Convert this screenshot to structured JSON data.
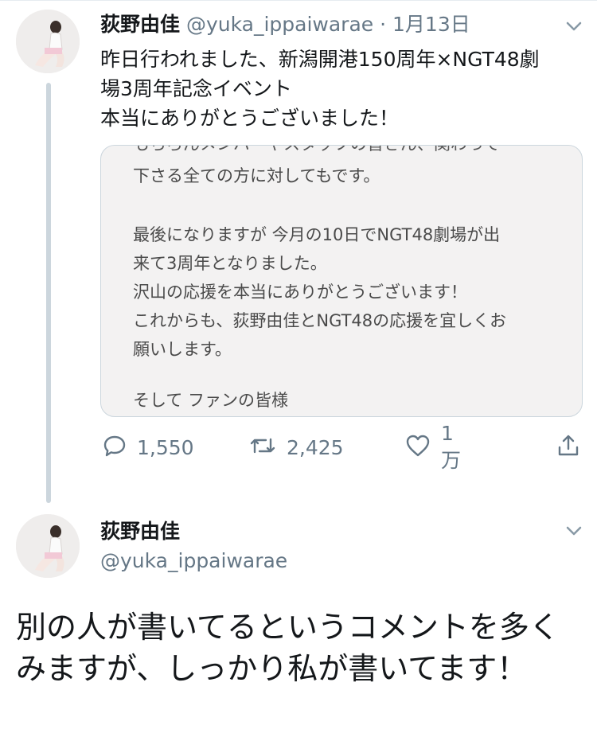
{
  "tweet1": {
    "name": "荻野由佳",
    "handle": "@yuka_ippaiwarae",
    "separator": "·",
    "date": "1月13日",
    "text_line1": "昨日行われました、新潟開港150周年×NGT48劇",
    "text_line2": "場3周年記念イベント",
    "text_line3": "本当にありがとうございました！",
    "media_lines": {
      "cut": "もちろんメンバーやスタッフの皆さん、関わって",
      "l1": "下さる全ての方に対してもです。",
      "l2": "最後になりますが 今月の10日でNGT48劇場が出",
      "l3": "来て3周年となりました。",
      "l4": "沢山の応援を本当にありがとうございます！",
      "l5": "これからも、荻野由佳とNGT48の応援を宜しくお",
      "l6": "願いします。",
      "l7": "そして ファンの皆様"
    },
    "reply_count": "1,550",
    "retweet_count": "2,425",
    "like_count": "1万"
  },
  "tweet2": {
    "name": "荻野由佳",
    "handle": "@yuka_ippaiwarae",
    "body": "別の人が書いてるというコメントを多くみますが、しっかり私が書いてます！"
  },
  "icons": {
    "caret": "chevron-down-icon",
    "reply": "reply-icon",
    "retweet": "retweet-icon",
    "like": "heart-icon",
    "share": "share-icon"
  },
  "colors": {
    "secondary_text": "#657786",
    "thread_line": "#ccd6dd",
    "media_bg": "#f3f2f2"
  }
}
